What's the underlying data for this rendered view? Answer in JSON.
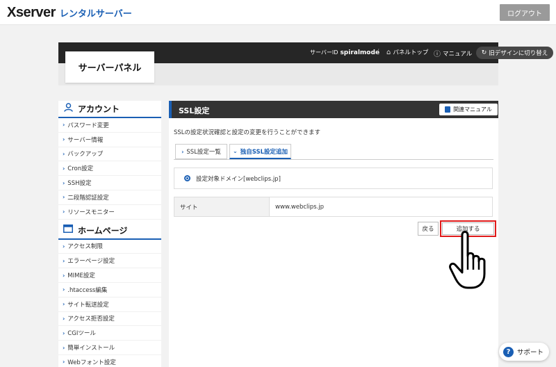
{
  "brand": {
    "logo": "Xserver",
    "subtitle": "レンタルサーバー"
  },
  "topbar": {
    "logout_label": "ログアウト"
  },
  "panel": {
    "title": "サーバーパネル",
    "server_id_label": "サーバーID",
    "server_id_value": "spiralmode",
    "separator": "/",
    "panel_top_label": "パネルトップ",
    "manual_label": "マニュアル",
    "old_design_label": "旧デザインに切り替え"
  },
  "sidebar": {
    "account_title": "アカウント",
    "account_items": [
      {
        "label": "パスワード変更"
      },
      {
        "label": "サーバー情報"
      },
      {
        "label": "バックアップ"
      },
      {
        "label": "Cron設定"
      },
      {
        "label": "SSH設定"
      },
      {
        "label": "二段階認証設定"
      },
      {
        "label": "リソースモニター"
      }
    ],
    "homepage_title": "ホームページ",
    "homepage_items": [
      {
        "label": "アクセス制限"
      },
      {
        "label": "エラーページ設定"
      },
      {
        "label": "MIME設定"
      },
      {
        "label": ".htaccess編集"
      },
      {
        "label": "サイト転送設定"
      },
      {
        "label": "アクセス拒否設定"
      },
      {
        "label": "CGIツール"
      },
      {
        "label": "簡単インストール"
      },
      {
        "label": "Webフォント設定"
      }
    ]
  },
  "main": {
    "title": "SSL設定",
    "manual_button": "関連マニュアル",
    "description": "SSLの設定状況確認と設定の変更を行うことができます",
    "tabs": [
      {
        "label": "SSL設定一覧",
        "active": false
      },
      {
        "label": "独自SSL設定追加",
        "active": true
      }
    ],
    "domain_label": "設定対象ドメイン[webclips.jp]",
    "site_label": "サイト",
    "site_value": "www.webclips.jp",
    "back_button": "戻る",
    "add_button": "追加する"
  },
  "support": {
    "label": "サポート",
    "icon": "?"
  },
  "colors": {
    "accent": "#1a5fb4",
    "highlight": "#e01a1a",
    "header_dark": "#262626"
  }
}
